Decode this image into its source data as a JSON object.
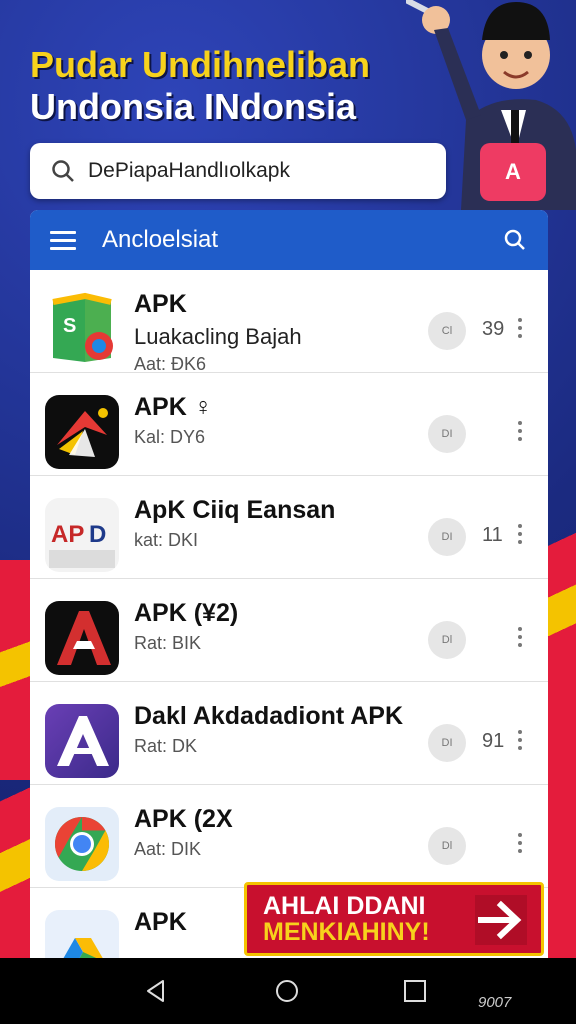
{
  "header": {
    "line1": "Pudar Undihneliban",
    "line2": "Undonsia INdonsia"
  },
  "search": {
    "value": "DePiapaHandlıolkapk",
    "placeholder": ""
  },
  "app_badge": {
    "label": "A"
  },
  "toolbar": {
    "title": "Ancloelsiat"
  },
  "apps": [
    {
      "name": "APK",
      "subtitle": "Luakacling Bajah",
      "meta": "Aat: ÐK6",
      "action": "Cl",
      "count": "39"
    },
    {
      "name": "APK ♀",
      "subtitle": "",
      "meta": "Kal: DY6",
      "action": "DI",
      "count": ""
    },
    {
      "name": "ApK Ciiq Eansan",
      "subtitle": "",
      "meta": "kat: DKI",
      "action": "DI",
      "count": "11"
    },
    {
      "name": "APK (¥2)",
      "subtitle": "",
      "meta": "Rat: BIK",
      "action": "Dl",
      "count": ""
    },
    {
      "name": "Dakl Akdadadiont APK",
      "subtitle": "",
      "meta": "Rat: DK",
      "action": "DI",
      "count": "91"
    },
    {
      "name": "APK (2X",
      "subtitle": "",
      "meta": "Aat: DIK",
      "action": "Dl",
      "count": ""
    },
    {
      "name": "APK",
      "subtitle": "",
      "meta": "",
      "action": "",
      "count": ""
    }
  ],
  "icon_names": [
    "maps-icon",
    "star-bird-icon",
    "apd-icon",
    "red-a-icon",
    "purple-a-icon",
    "chrome-icon",
    "drive-icon"
  ],
  "promo": {
    "line1": "AHLAI DDANI",
    "line2": "MENKIAHINY!"
  },
  "navbar": {
    "version": "9007"
  },
  "colors": {
    "toolbar": "#1f5cc9",
    "brand_red": "#c8102e",
    "brand_yellow": "#f4c300",
    "bg_blue": "#1d2d86"
  }
}
